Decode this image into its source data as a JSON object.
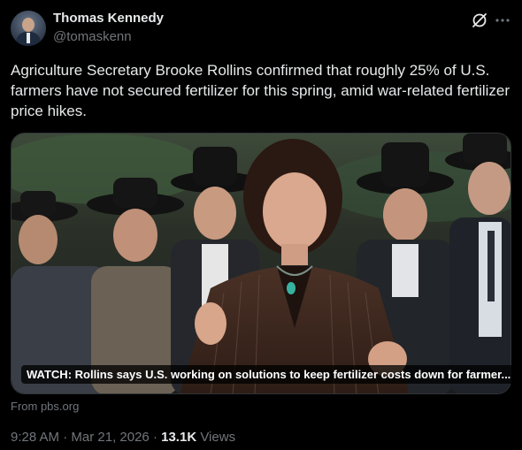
{
  "author": {
    "name": "Thomas Kennedy",
    "handle": "@tomaskenn"
  },
  "tweet": {
    "text": "Agriculture Secretary Brooke Rollins confirmed that roughly 25% of U.S. farmers have not secured fertilizer for this spring, amid war-related fertilizer price hikes."
  },
  "media": {
    "caption": "WATCH: Rollins says U.S. working on solutions to keep fertilizer costs down for farmer...",
    "source": "From pbs.org"
  },
  "meta": {
    "time": "9:28 AM",
    "date": "Mar 21, 2026",
    "separator": "·",
    "views_count": "13.1K",
    "views_label": "Views"
  },
  "icons": {
    "grok": "grok-icon",
    "more": "more-horizontal-icon"
  },
  "colors": {
    "background": "#000000",
    "text_primary": "#e7e9ea",
    "text_secondary": "#71767b"
  }
}
